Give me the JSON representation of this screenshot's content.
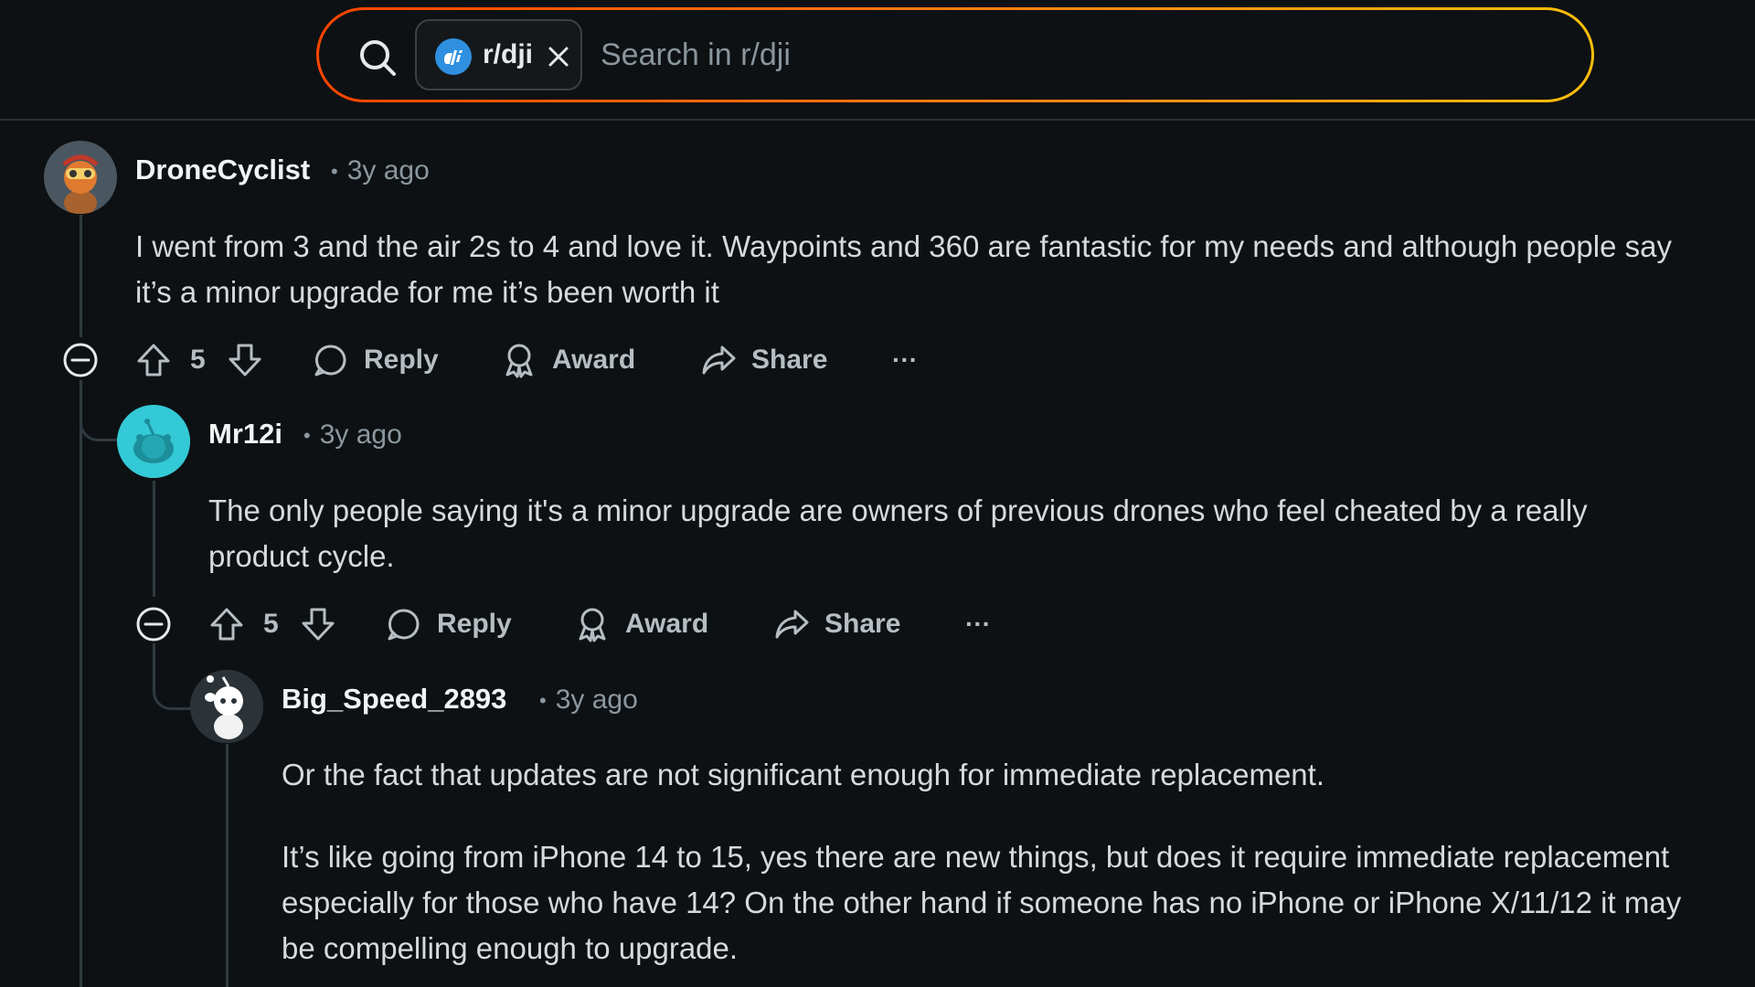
{
  "search": {
    "community_chip": "r/dji",
    "placeholder": "Search in r/dji"
  },
  "comments": [
    {
      "username": "DroneCyclist",
      "time": "3y ago",
      "paragraphs": [
        "I went from 3 and the air 2s to 4 and love it. Waypoints and 360 are fantastic for my needs and although people say it’s a minor upgrade for me it’s been worth it"
      ],
      "votes": "5",
      "actions": {
        "reply": "Reply",
        "award": "Award",
        "share": "Share",
        "more": "···"
      }
    },
    {
      "username": "Mr12i",
      "time": "3y ago",
      "paragraphs": [
        "The only people saying it's a minor upgrade are owners of previous drones who feel cheated by a really product cycle."
      ],
      "votes": "5",
      "actions": {
        "reply": "Reply",
        "award": "Award",
        "share": "Share",
        "more": "···"
      }
    },
    {
      "username": "Big_Speed_2893",
      "time": "3y ago",
      "paragraphs": [
        "Or the fact that updates are not significant enough for immediate replacement.",
        "It’s like going from iPhone 14 to 15, yes there are new things, but does it require immediate replacement especially for those who have 14? On the other hand if someone has no iPhone or iPhone X/11/12 it may be compelling enough to upgrade."
      ]
    }
  ]
}
